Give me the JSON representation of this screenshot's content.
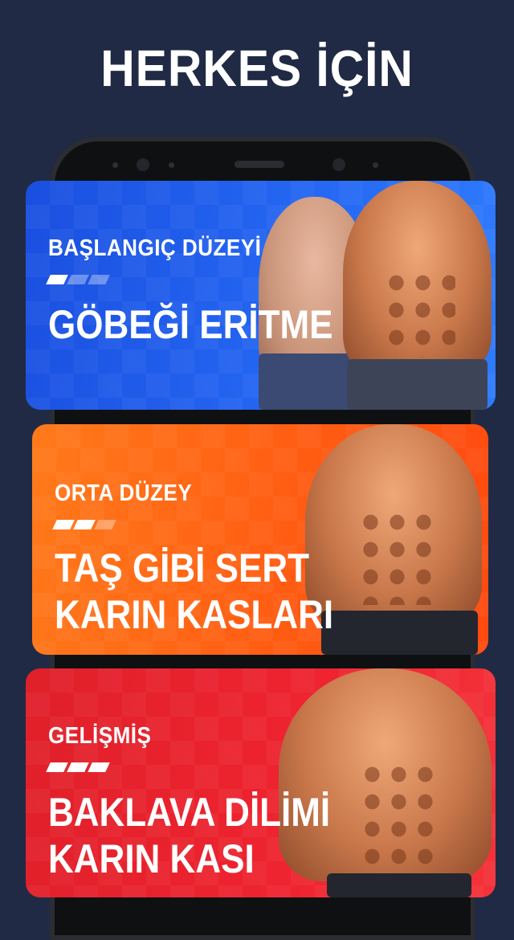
{
  "header": {
    "title": "HERKES İÇİN"
  },
  "cards": [
    {
      "level": "BAŞLANGIÇ DÜZEYİ",
      "progress": 1,
      "progress_total": 3,
      "title_line1": "GÖBEĞİ ERİTME",
      "title_line2": "",
      "color": "#2466f2"
    },
    {
      "level": "ORTA DÜZEY",
      "progress": 2,
      "progress_total": 3,
      "title_line1": "TAŞ GİBİ SERT",
      "title_line2": "KARIN KASLARI",
      "color": "#ff5a12"
    },
    {
      "level": "GELİŞMİŞ",
      "progress": 3,
      "progress_total": 3,
      "title_line1": "BAKLAVA DİLİMİ",
      "title_line2": "KARIN KASI",
      "color": "#ef2430"
    }
  ]
}
